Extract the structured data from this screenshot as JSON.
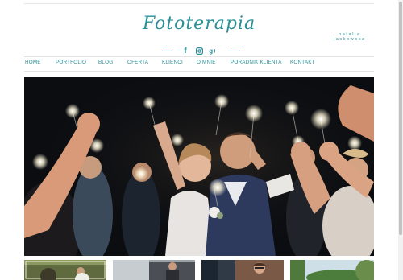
{
  "header": {
    "logo_title": "Fototerapia",
    "logo_subtitle": "natalia jaskowska"
  },
  "social": {
    "icons": [
      "facebook-icon",
      "instagram-icon",
      "google-plus-icon"
    ],
    "facebook_glyph": "f",
    "google_glyph": "g+"
  },
  "nav": {
    "items": [
      "HOME",
      "PORTFOLIO",
      "BLOG",
      "OFERTA",
      "KLIENCI",
      "O MNIE",
      "PORADNIK KLIENTA",
      "KONTAKT"
    ]
  },
  "colors": {
    "accent": "#2a8f97",
    "hero_background": "#0b0d11"
  }
}
